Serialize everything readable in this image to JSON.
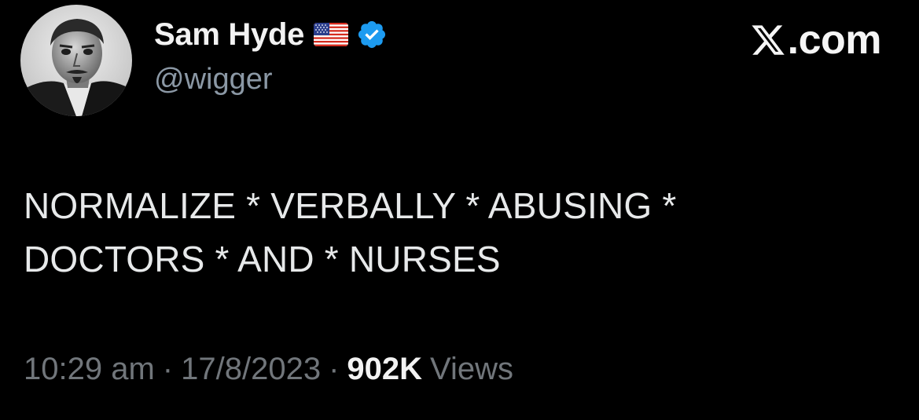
{
  "author": {
    "display_name": "Sam Hyde",
    "handle": "@wigger",
    "flag_icon": "us-flag-icon",
    "verified_icon": "verified-badge-icon",
    "verified_color": "#1d9bf0"
  },
  "brand": {
    "logo_icon": "x-logo-icon",
    "text": ".com"
  },
  "tweet": {
    "lines": [
      "NORMALIZE * VERBALLY * ABUSING *",
      "DOCTORS * AND * NURSES"
    ]
  },
  "meta": {
    "time": "10:29 am",
    "separator": "·",
    "date": "17/8/2023",
    "views_count": "902K",
    "views_label": "Views"
  },
  "colors": {
    "background": "#000000",
    "primary_text": "#e7e9ea",
    "secondary_text": "#71767b",
    "handle_text": "#8b98a5"
  }
}
